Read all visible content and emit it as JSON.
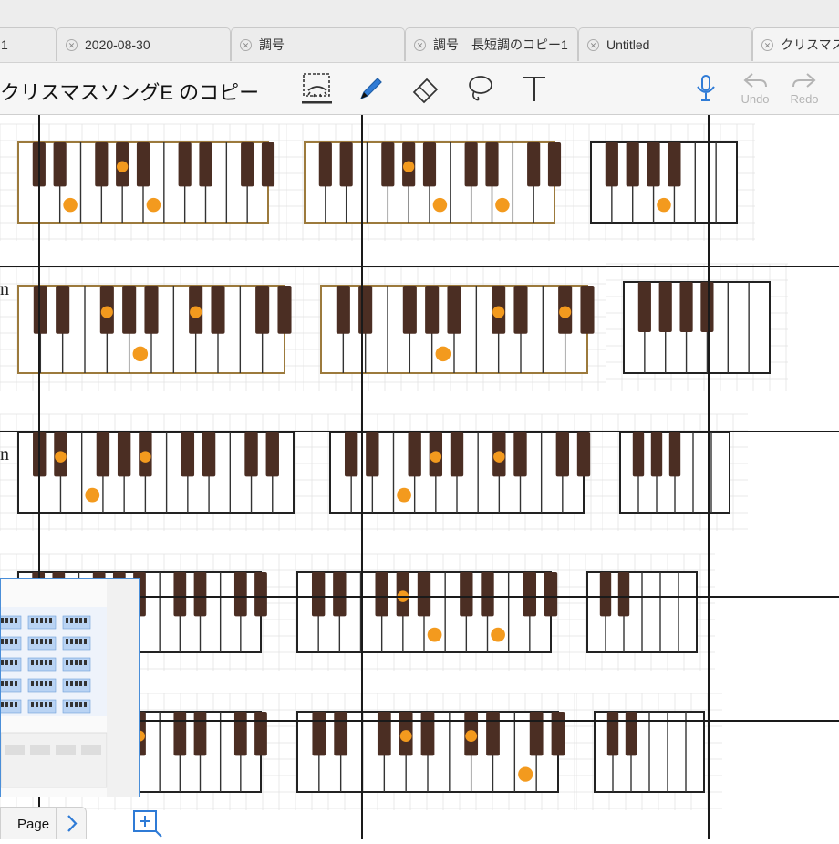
{
  "tabs": [
    {
      "label": "1"
    },
    {
      "label": "2020-08-30"
    },
    {
      "label": "調号"
    },
    {
      "label": "調号　長短調のコピー1"
    },
    {
      "label": "Untitled"
    },
    {
      "label": "クリスマスソ"
    }
  ],
  "document": {
    "title": "クリスマスソングE のコピー"
  },
  "toolbar": {
    "tools": [
      "read-mode-icon",
      "pen-icon",
      "eraser-icon",
      "lasso-icon",
      "text-icon"
    ],
    "undo_label": "Undo",
    "redo_label": "Redo",
    "accent": "#2f7bd6"
  },
  "rows": [
    {
      "label": ""
    },
    {
      "label": "n"
    },
    {
      "label": "n"
    }
  ],
  "keyboard": {
    "dot_color": "#f39a1e",
    "black_key_color": "#4b2e23",
    "frame_color": "#9c7a3c"
  },
  "pager": {
    "label": "Page"
  }
}
